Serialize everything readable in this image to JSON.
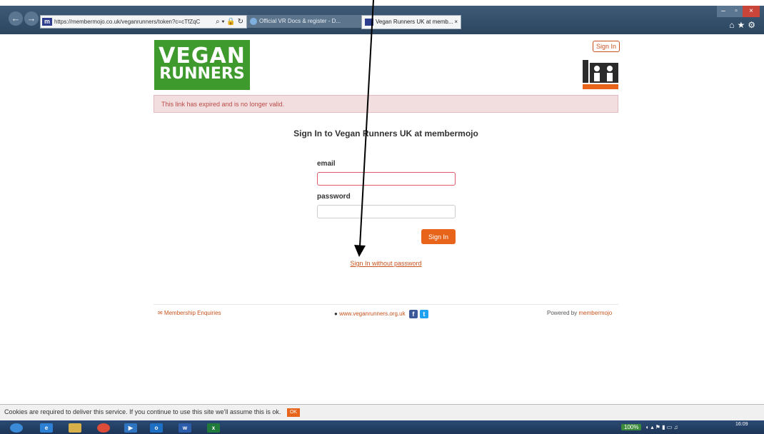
{
  "browser": {
    "url": "https://membermojo.co.uk/veganrunners/token?c=cTfZqC",
    "tabs": [
      {
        "label": "Official VR Docs & register - D..."
      },
      {
        "label": "Vegan Runners UK at memb..."
      }
    ],
    "tab_close": "×",
    "address_controls": "⌕ ▾ 🔒 ↻"
  },
  "page": {
    "logo_line1": "VEGAN",
    "logo_line2": "RUNNERS",
    "signin_top": "Sign In",
    "alert": "This link has expired and is no longer valid.",
    "heading": "Sign In to Vegan Runners UK at membermojo",
    "email_label": "email",
    "email_value": "",
    "password_label": "password",
    "password_value": "",
    "signin_button": "Sign In",
    "signin_without_password": "Sign In without password"
  },
  "footer": {
    "enquiries": "✉ Membership Enquiries",
    "website": "www.veganrunners.org.uk",
    "powered_by": "Powered by",
    "powered_brand": "membermojo"
  },
  "cookie_bar": {
    "text": "Cookies are required to deliver this service. If you continue to use this site we'll assume this is ok.",
    "ok": "OK"
  },
  "taskbar": {
    "zoom": "100%",
    "time": "16:09"
  },
  "colors": {
    "brand_green": "#3f9a2e",
    "accent_orange": "#e8641b",
    "alert_bg": "#f2dede"
  }
}
